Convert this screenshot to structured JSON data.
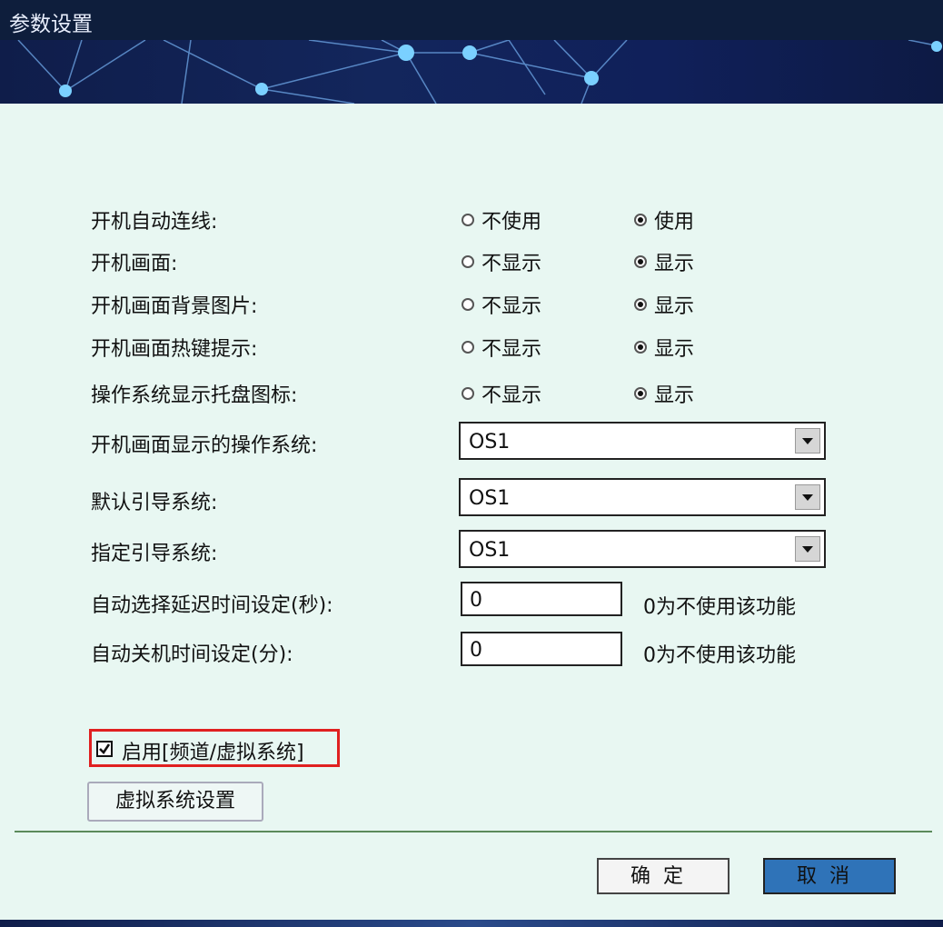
{
  "window": {
    "title": "参数设置"
  },
  "options": [
    {
      "label": "开机自动连线:",
      "opt1": "不使用",
      "opt2": "使用",
      "selected": 2
    },
    {
      "label": "开机画面:",
      "opt1": "不显示",
      "opt2": "显示",
      "selected": 2
    },
    {
      "label": "开机画面背景图片:",
      "opt1": "不显示",
      "opt2": "显示",
      "selected": 2
    },
    {
      "label": "开机画面热键提示:",
      "opt1": "不显示",
      "opt2": "显示",
      "selected": 2
    },
    {
      "label": "操作系统显示托盘图标:",
      "opt1": "不显示",
      "opt2": "显示",
      "selected": 2
    }
  ],
  "selects": [
    {
      "label": "开机画面显示的操作系统:",
      "value": "OS1"
    },
    {
      "label": "默认引导系统:",
      "value": "OS1"
    },
    {
      "label": "指定引导系统:",
      "value": "OS1"
    }
  ],
  "delays": [
    {
      "label": "自动选择延迟时间设定(秒):",
      "value": "0",
      "hint": "0为不使用该功能"
    },
    {
      "label": "自动关机时间设定(分):",
      "value": "0",
      "hint": "0为不使用该功能"
    }
  ],
  "virtual_system": {
    "checkbox_label": "启用[频道/虚拟系统]",
    "checked": true,
    "settings_button": "虚拟系统设置"
  },
  "buttons": {
    "ok": "确定",
    "cancel": "取消"
  },
  "colors": {
    "title_bar": "#0e1e3c",
    "background": "#e8f7f2",
    "highlight": "#e02020",
    "primary_button": "#2f73b8"
  }
}
